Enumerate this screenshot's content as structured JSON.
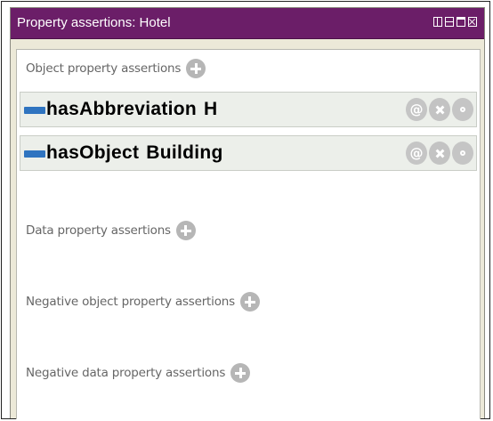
{
  "window": {
    "title": "Property assertions: Hotel",
    "controls": [
      "split-view-icon",
      "horizontal-split-icon",
      "maximize-icon",
      "close-icon"
    ],
    "titlebar_color": "#6b1e68"
  },
  "sections": {
    "object_property": {
      "label": "Object property assertions",
      "assertions": [
        {
          "property": "hasAbbreviation",
          "value": "H"
        },
        {
          "property": "hasObject",
          "value": "Building"
        }
      ]
    },
    "data_property": {
      "label": "Data property assertions"
    },
    "negative_object_property": {
      "label": "Negative object property assertions"
    },
    "negative_data_property": {
      "label": "Negative data property assertions"
    }
  },
  "row_buttons": {
    "annotate": "@",
    "icons": [
      "annotate-icon",
      "delete-icon",
      "explain-icon"
    ]
  },
  "colors": {
    "property_icon": "#2f74c0",
    "assertion_row_bg": "#ecefea",
    "add_button": "#b6b6b6"
  }
}
